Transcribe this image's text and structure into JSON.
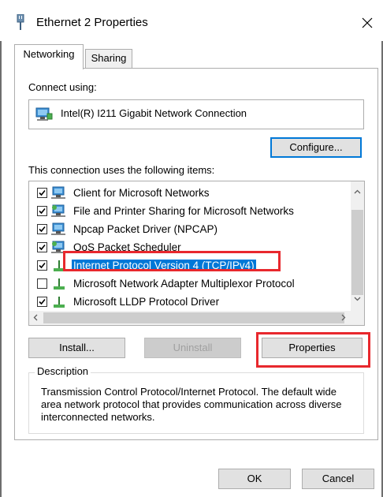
{
  "window": {
    "title": "Ethernet 2 Properties",
    "close_label": "×"
  },
  "tabs": [
    {
      "label": "Networking",
      "active": true
    },
    {
      "label": "Sharing",
      "active": false
    }
  ],
  "connect": {
    "label": "Connect using:",
    "adapter": "Intel(R) I211 Gigabit Network Connection",
    "configure_label": "Configure..."
  },
  "items": {
    "label": "This connection uses the following items:",
    "list": [
      {
        "label": "Client for Microsoft Networks",
        "checked": true,
        "icon": "network-client-icon"
      },
      {
        "label": "File and Printer Sharing for Microsoft Networks",
        "checked": true,
        "icon": "network-service-icon"
      },
      {
        "label": "Npcap Packet Driver (NPCAP)",
        "checked": true,
        "icon": "network-client-icon"
      },
      {
        "label": "QoS Packet Scheduler",
        "checked": true,
        "icon": "network-service-icon"
      },
      {
        "label": "Internet Protocol Version 4 (TCP/IPv4)",
        "checked": true,
        "icon": "protocol-icon",
        "selected": true
      },
      {
        "label": "Microsoft Network Adapter Multiplexor Protocol",
        "checked": false,
        "icon": "protocol-icon"
      },
      {
        "label": "Microsoft LLDP Protocol Driver",
        "checked": true,
        "icon": "protocol-icon"
      }
    ]
  },
  "buttons": {
    "install": "Install...",
    "uninstall": "Uninstall",
    "properties": "Properties"
  },
  "description": {
    "legend": "Description",
    "text": "Transmission Control Protocol/Internet Protocol. The default wide area network protocol that provides communication across diverse interconnected networks."
  },
  "dialog": {
    "ok": "OK",
    "cancel": "Cancel"
  },
  "colors": {
    "accent": "#0078d7",
    "highlight": "#e8282d"
  }
}
